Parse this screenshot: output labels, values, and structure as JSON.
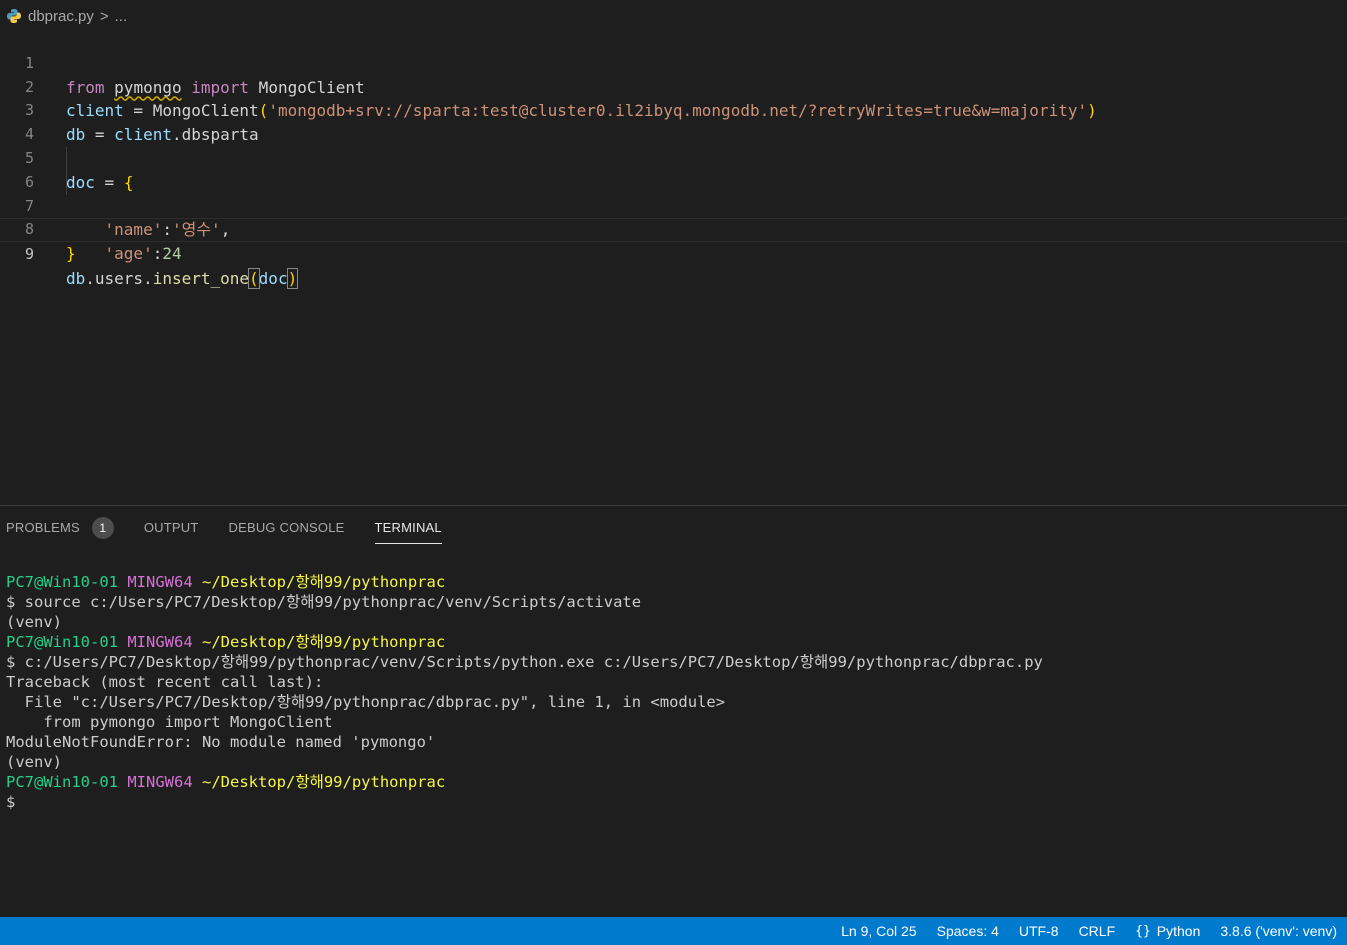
{
  "breadcrumb": {
    "file": "dbprac.py",
    "separator": ">",
    "more": "..."
  },
  "editor": {
    "lines": [
      {
        "n": "1",
        "t": [
          "from",
          " ",
          "pymongo",
          " ",
          "import",
          " MongoClient"
        ]
      },
      {
        "n": "2",
        "t": [
          "client",
          " = ",
          "MongoClient",
          "(",
          "'mongodb+srv://sparta:test@cluster0.il2ibyq.mongodb.net/?retryWrites=true&w=majority'",
          ")"
        ]
      },
      {
        "n": "3",
        "t": [
          "db",
          " = ",
          "client",
          ".dbsparta"
        ]
      },
      {
        "n": "4",
        "t": []
      },
      {
        "n": "5",
        "t": [
          "doc",
          " = ",
          "{"
        ]
      },
      {
        "n": "6",
        "t": [
          "    ",
          "'name'",
          ":",
          "'영수'",
          ","
        ]
      },
      {
        "n": "7",
        "t": [
          "    ",
          "'age'",
          ":",
          "24"
        ]
      },
      {
        "n": "8",
        "t": [
          "}"
        ]
      },
      {
        "n": "9",
        "t": [
          "db",
          ".users.",
          "insert_one",
          "(",
          "doc",
          ")"
        ]
      }
    ]
  },
  "panel": {
    "tabs": [
      {
        "label": "PROBLEMS",
        "badge": "1"
      },
      {
        "label": "OUTPUT"
      },
      {
        "label": "DEBUG CONSOLE"
      },
      {
        "label": "TERMINAL",
        "active": true
      }
    ],
    "terminal": {
      "prompt_user": "PC7@Win10-01",
      "prompt_shell": "MINGW64",
      "prompt_path": "~/Desktop/항해99/pythonprac",
      "cmd1": "$ source c:/Users/PC7/Desktop/항해99/pythonprac/venv/Scripts/activate",
      "venv": "(venv)",
      "cmd2": "$ c:/Users/PC7/Desktop/항해99/pythonprac/venv/Scripts/python.exe c:/Users/PC7/Desktop/항해99/pythonprac/dbprac.py",
      "tb1": "Traceback (most recent call last):",
      "tb2": "  File \"c:/Users/PC7/Desktop/항해99/pythonprac/dbprac.py\", line 1, in <module>",
      "tb3": "    from pymongo import MongoClient",
      "tb4": "ModuleNotFoundError: No module named 'pymongo'",
      "cursor": "$"
    }
  },
  "statusbar": {
    "position": "Ln 9, Col 25",
    "spaces": "Spaces: 4",
    "encoding": "UTF-8",
    "eol": "CRLF",
    "language": "Python",
    "interpreter": "3.8.6 ('venv': venv)"
  },
  "colors": {
    "statusbar": "#007acc",
    "keyword": "#c586c0",
    "string": "#ce9178",
    "variable": "#9cdcfe"
  }
}
